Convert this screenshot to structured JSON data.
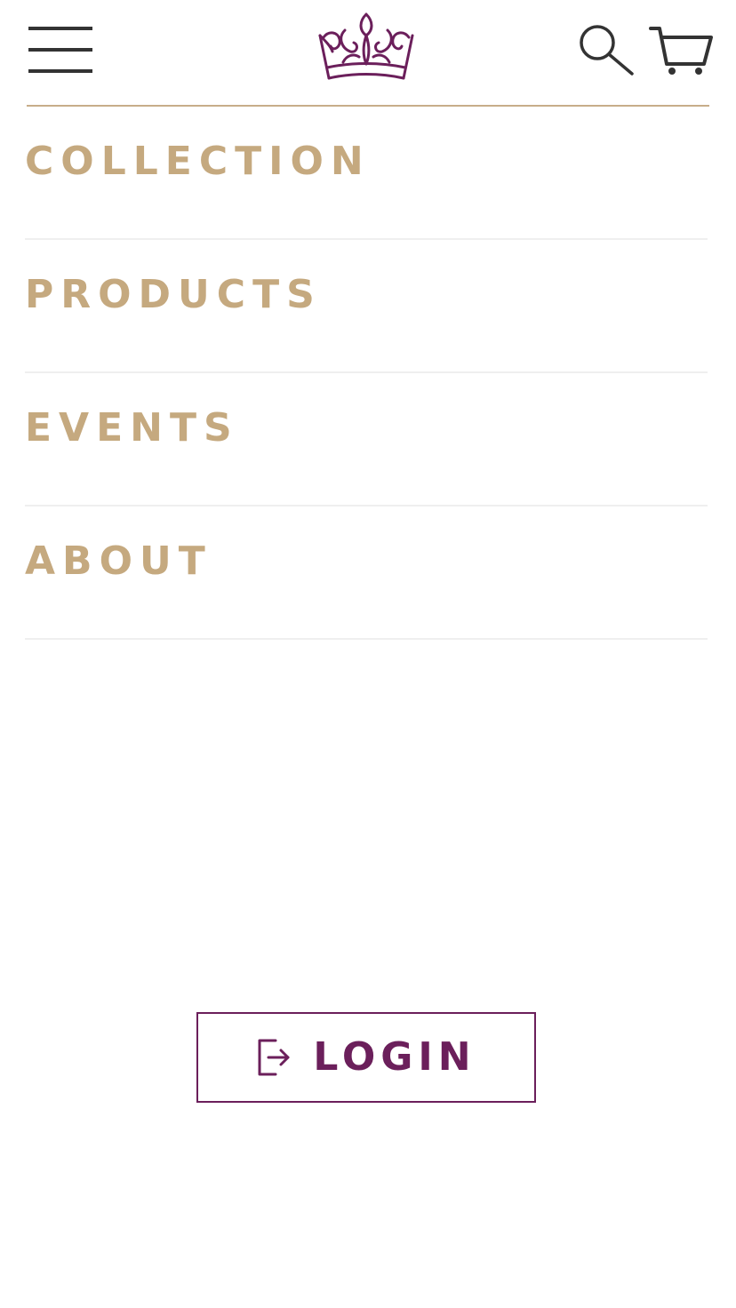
{
  "header": {
    "menu_icon": "hamburger-menu-icon",
    "logo_icon": "crown-logo-icon",
    "search_icon": "search-icon",
    "cart_icon": "shopping-cart-icon"
  },
  "nav": {
    "items": [
      {
        "label": "COLLECTION"
      },
      {
        "label": "PRODUCTS"
      },
      {
        "label": "EVENTS"
      },
      {
        "label": "ABOUT"
      }
    ]
  },
  "login": {
    "label": "LOGIN",
    "icon": "login-arrow-icon"
  },
  "colors": {
    "accent_gold": "#c5a97f",
    "brand_purple": "#6b1f5b",
    "icon_dark": "#333333",
    "divider": "#efefef"
  }
}
